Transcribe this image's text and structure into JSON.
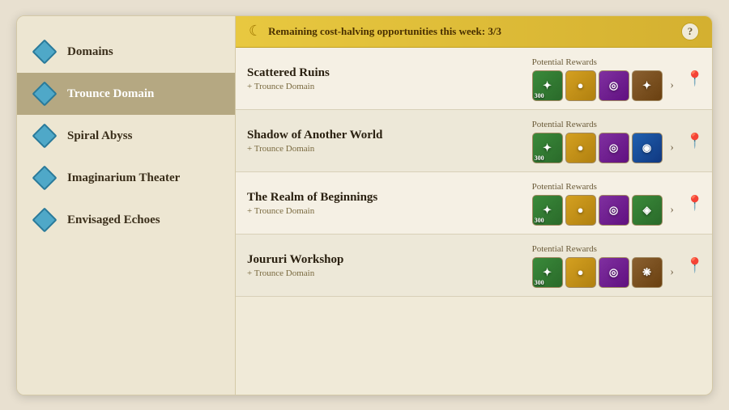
{
  "banner": {
    "text": "Remaining cost-halving opportunities this week: 3/3",
    "question_label": "?"
  },
  "sidebar": {
    "items": [
      {
        "id": "domains",
        "label": "Domains",
        "active": false
      },
      {
        "id": "trounce-domain",
        "label": "Trounce Domain",
        "active": true
      },
      {
        "id": "spiral-abyss",
        "label": "Spiral Abyss",
        "active": false
      },
      {
        "id": "imaginarium-theater",
        "label": "Imaginarium Theater",
        "active": false
      },
      {
        "id": "envisaged-echoes",
        "label": "Envisaged Echoes",
        "active": false
      }
    ]
  },
  "list": {
    "items": [
      {
        "title": "Scattered Ruins",
        "subtitle": "+ Trounce Domain",
        "rewards_label": "Potential Rewards",
        "rewards": [
          {
            "type": "green",
            "symbol": "✦",
            "number": "300"
          },
          {
            "type": "gold",
            "symbol": "●",
            "number": ""
          },
          {
            "type": "purple",
            "symbol": "◎",
            "number": ""
          },
          {
            "type": "brown",
            "symbol": "✦",
            "number": ""
          }
        ]
      },
      {
        "title": "Shadow of Another World",
        "subtitle": "+ Trounce Domain",
        "rewards_label": "Potential Rewards",
        "rewards": [
          {
            "type": "green",
            "symbol": "✦",
            "number": "300"
          },
          {
            "type": "gold",
            "symbol": "●",
            "number": ""
          },
          {
            "type": "purple",
            "symbol": "◎",
            "number": ""
          },
          {
            "type": "blue",
            "symbol": "◉",
            "number": ""
          }
        ]
      },
      {
        "title": "The Realm of Beginnings",
        "subtitle": "+ Trounce Domain",
        "rewards_label": "Potential Rewards",
        "rewards": [
          {
            "type": "green",
            "symbol": "✦",
            "number": "300"
          },
          {
            "type": "gold",
            "symbol": "●",
            "number": ""
          },
          {
            "type": "purple",
            "symbol": "◎",
            "number": ""
          },
          {
            "type": "green",
            "symbol": "◈",
            "number": ""
          }
        ]
      },
      {
        "title": "Joururi Workshop",
        "subtitle": "+ Trounce Domain",
        "rewards_label": "Potential Rewards",
        "rewards": [
          {
            "type": "green",
            "symbol": "✦",
            "number": "300"
          },
          {
            "type": "gold",
            "symbol": "●",
            "number": ""
          },
          {
            "type": "purple",
            "symbol": "◎",
            "number": ""
          },
          {
            "type": "brown",
            "symbol": "❋",
            "number": ""
          }
        ]
      }
    ]
  }
}
